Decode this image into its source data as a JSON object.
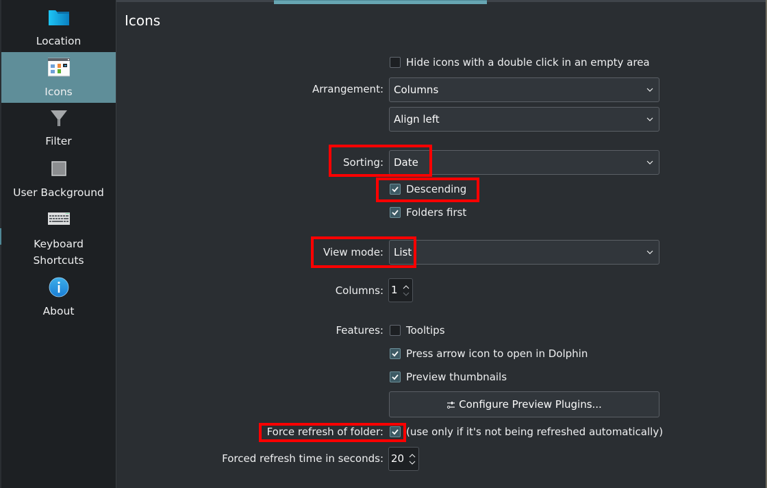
{
  "sidebar": {
    "items": [
      {
        "label": "Location",
        "icon": "folder-icon",
        "active": false
      },
      {
        "label": "Icons",
        "icon": "icons-view-icon",
        "active": true
      },
      {
        "label": "Filter",
        "icon": "filter-funnel-icon",
        "active": false
      },
      {
        "label": "User Background",
        "icon": "background-square-icon",
        "active": false
      },
      {
        "label": "Keyboard",
        "label2": "Shortcuts",
        "icon": "keyboard-icon",
        "active": false
      },
      {
        "label": "About",
        "icon": "info-icon",
        "active": false
      }
    ]
  },
  "page": {
    "title": "Icons"
  },
  "form": {
    "hide_icons": {
      "label": "Hide icons with a double click in an empty area",
      "checked": false
    },
    "arrangement": {
      "label": "Arrangement:",
      "value": "Columns"
    },
    "alignment": {
      "value": "Align left"
    },
    "sorting": {
      "label": "Sorting:",
      "value": "Date"
    },
    "descending": {
      "label": "Descending",
      "checked": true
    },
    "folders_first": {
      "label": "Folders first",
      "checked": true
    },
    "view_mode": {
      "label": "View mode:",
      "value": "List"
    },
    "columns": {
      "label": "Columns:",
      "value": "1"
    },
    "features": {
      "label": "Features:",
      "tooltips": {
        "label": "Tooltips",
        "checked": false
      },
      "press_arrow": {
        "label": "Press arrow icon to open in Dolphin",
        "checked": true
      },
      "preview_thumbnails": {
        "label": "Preview thumbnails",
        "checked": true
      }
    },
    "configure_button": {
      "label": "Configure Preview Plugins...",
      "icon": "configure-sliders-icon"
    },
    "force_refresh": {
      "label": "Force refresh of folder:",
      "checked": true,
      "hint": "(use only if it's not being refreshed automatically)"
    },
    "refresh_time": {
      "label": "Forced refresh time in seconds:",
      "value": "20"
    }
  },
  "colors": {
    "accent": "#5f8e99",
    "highlight_box": "#ff0000",
    "background": "#2a2e32",
    "sidebar_bg": "#1d2023"
  }
}
